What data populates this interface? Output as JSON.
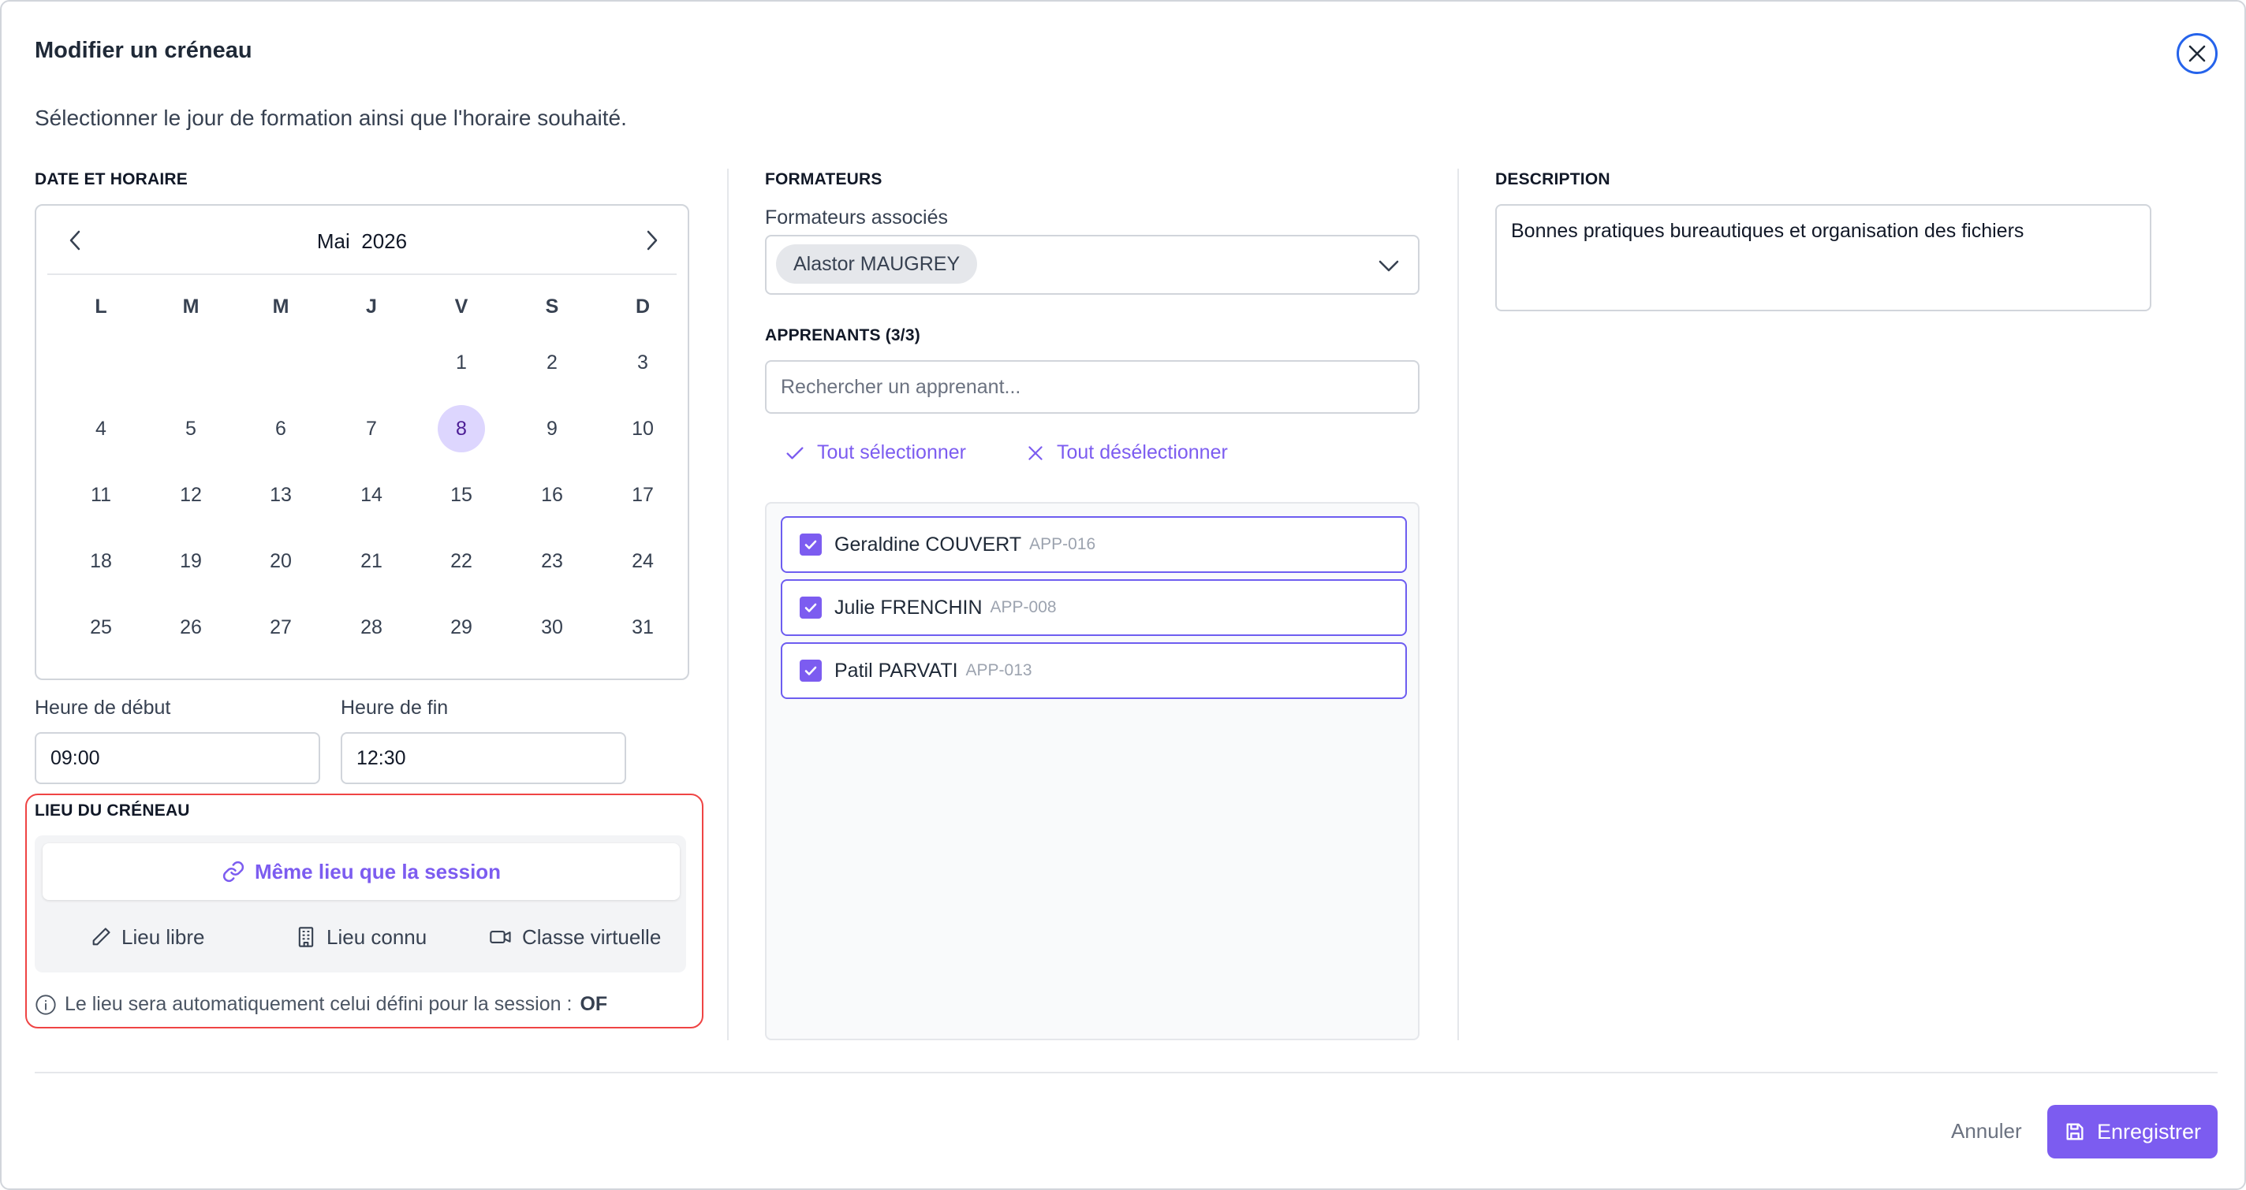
{
  "modal": {
    "title": "Modifier un créneau",
    "subtitle": "Sélectionner le jour de formation ainsi que l'horaire souhaité."
  },
  "date_section": {
    "label": "DATE ET HORAIRE",
    "calendar": {
      "month": "Mai",
      "year": "2026",
      "weekdays": [
        "L",
        "M",
        "M",
        "J",
        "V",
        "S",
        "D"
      ],
      "selected_day": "8"
    },
    "start_label": "Heure de début",
    "start_value": "09:00",
    "end_label": "Heure de fin",
    "end_value": "12:30"
  },
  "lieu": {
    "label": "LIEU DU CRÉNEAU",
    "same_location": "Même lieu que la session",
    "options": [
      "Lieu libre",
      "Lieu connu",
      "Classe virtuelle"
    ],
    "info_text": "Le lieu sera automatiquement celui défini pour la session :",
    "info_value": "OF"
  },
  "formateurs": {
    "label": "FORMATEURS",
    "sub_label": "Formateurs associés",
    "tags": [
      "Alastor MAUGREY"
    ]
  },
  "apprenants": {
    "label": "APPRENANTS (3/3)",
    "search_placeholder": "Rechercher un apprenant...",
    "select_all": "Tout sélectionner",
    "deselect_all": "Tout désélectionner",
    "items": [
      {
        "name": "Geraldine COUVERT",
        "code": "APP-016",
        "checked": true
      },
      {
        "name": "Julie FRENCHIN",
        "code": "APP-008",
        "checked": true
      },
      {
        "name": "Patil PARVATI",
        "code": "APP-013",
        "checked": true
      }
    ]
  },
  "description": {
    "label": "DESCRIPTION",
    "value": "Bonnes pratiques bureautiques et organisation des fichiers"
  },
  "footer": {
    "cancel": "Annuler",
    "save": "Enregistrer"
  },
  "colors": {
    "accent": "#7c5cf0",
    "selected_day_bg": "#ddd6fe",
    "close_border": "#2563eb",
    "highlight_outline": "#ef4444"
  }
}
